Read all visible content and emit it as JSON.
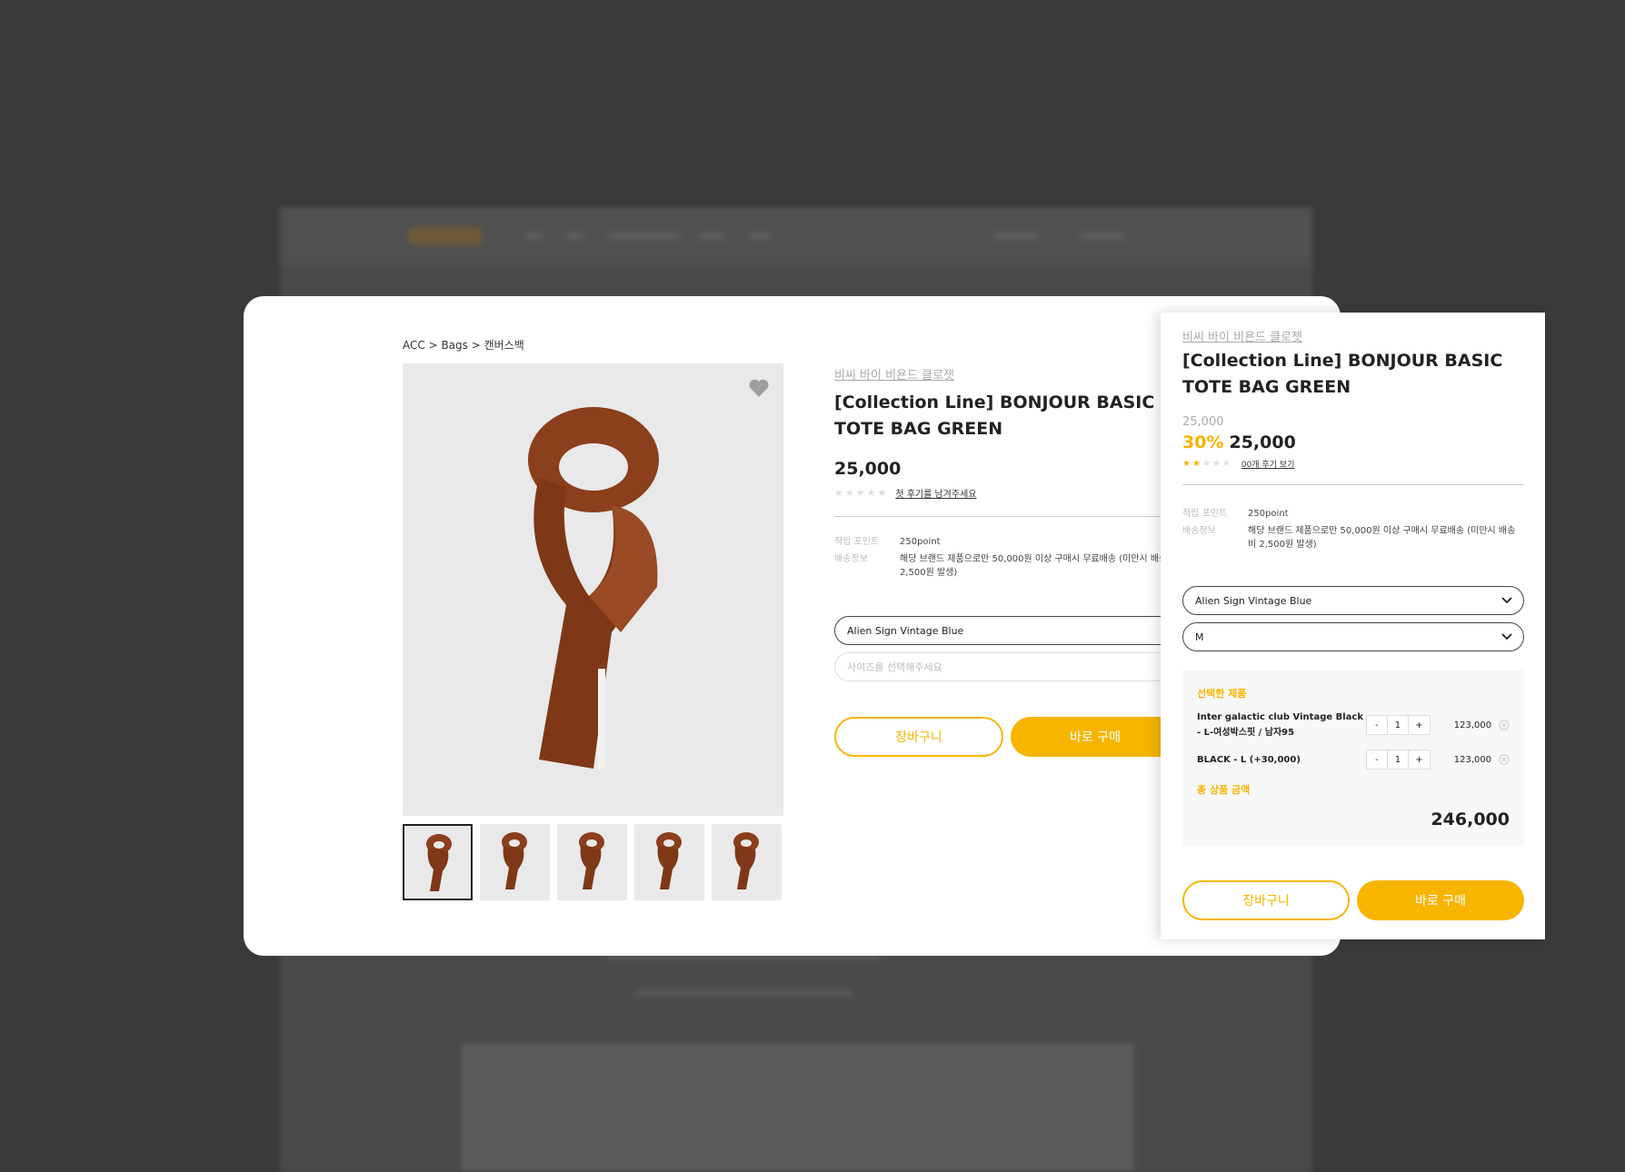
{
  "main": {
    "breadcrumb": "ACC > Bags > 캔버스백",
    "brand": "비씨 바이 비욘드 클로젯",
    "title": "[Collection Line] BONJOUR BASIC TOTE BAG GREEN",
    "price": "25,000",
    "stars": "★★★★★",
    "review_link": "첫 후기를 남겨주세요",
    "point_label": "적립 포인트",
    "point_value": "250point",
    "shipping_label": "배송정보",
    "shipping_value": "해당 브랜드 제품으로만 50,000원 이상 구매시 무료배송 (미만시 배송비 2,500원 발생)",
    "color_select": "Alien Sign Vintage Blue",
    "size_placeholder": "사이즈를 선택해주세요",
    "cart_button": "장바구니",
    "buy_button": "바로 구매"
  },
  "panel": {
    "brand": "비씨 바이 비욘드 클로젯",
    "title": "[Collection Line] BONJOUR BASIC TOTE BAG GREEN",
    "original_price": "25,000",
    "discount": "30%",
    "sale_price": "25,000",
    "rating": 2,
    "review_link": "00개 후기 보기",
    "point_label": "적립 포인트",
    "point_value": "250point",
    "shipping_label": "배송정보",
    "shipping_value": "해당 브랜드 제품으로만 50,000원 이상 구매시 무료배송 (미만시 배송비 2,500원 발생)",
    "color_select": "Alien Sign Vintage Blue",
    "size_select": "M",
    "selected_title": "선택한 제품",
    "items": [
      {
        "name": "Inter galactic club Vintage Black - L-여성박스핏 / 남자95",
        "qty": "1",
        "price": "123,000"
      },
      {
        "name": "BLACK - L (+30,000)",
        "qty": "1",
        "price": "123,000"
      }
    ],
    "total_label": "총 상품 금액",
    "total_value": "246,000",
    "cart_button": "장바구니",
    "buy_button": "바로 구매"
  },
  "colors": {
    "accent": "#f7b500",
    "scarf": "#8b3f1c"
  }
}
